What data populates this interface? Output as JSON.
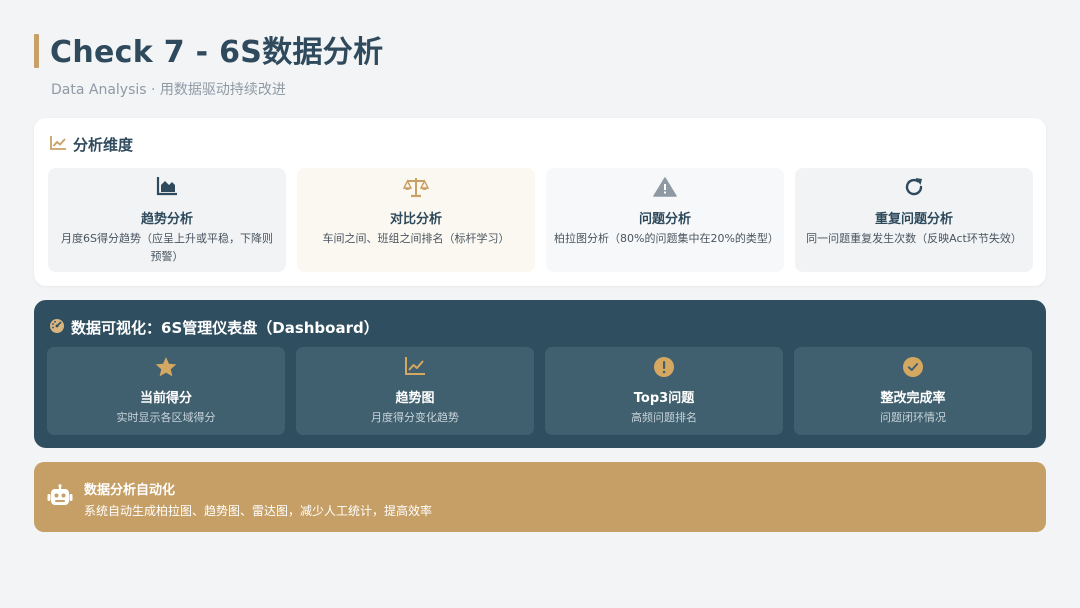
{
  "header": {
    "title": "Check 7 - 6S数据分析",
    "subtitle": "Data Analysis · 用数据驱动持续改进"
  },
  "dimensions": {
    "title": "分析维度",
    "icon": "line-chart-icon",
    "items": [
      {
        "name": "趋势分析",
        "desc": "月度6S得分趋势（应呈上升或平稳，下降则预警）",
        "icon": "area-chart-icon",
        "bg": "#f1f3f5"
      },
      {
        "name": "对比分析",
        "desc": "车间之间、班组之间排名（标杆学习）",
        "icon": "balance-scale-icon",
        "bg": "#fbf8f2"
      },
      {
        "name": "问题分析",
        "desc": "柏拉图分析（80%的问题集中在20%的类型）",
        "icon": "warning-icon",
        "bg": "#f7f8f9"
      },
      {
        "name": "重复问题分析",
        "desc": "同一问题重复发生次数（反映Act环节失效）",
        "icon": "redo-icon",
        "bg": "#f1f3f5"
      }
    ]
  },
  "dashboard": {
    "title": "数据可视化：6S管理仪表盘（Dashboard）",
    "icon": "gauge-icon",
    "items": [
      {
        "name": "当前得分",
        "desc": "实时显示各区域得分",
        "icon": "star-icon"
      },
      {
        "name": "趋势图",
        "desc": "月度得分变化趋势",
        "icon": "line-chart-icon"
      },
      {
        "name": "Top3问题",
        "desc": "高频问题排名",
        "icon": "exclamation-circle-icon"
      },
      {
        "name": "整改完成率",
        "desc": "问题闭环情况",
        "icon": "check-circle-icon"
      }
    ]
  },
  "automation": {
    "title": "数据分析自动化",
    "desc": "系统自动生成柏拉图、趋势图、雷达图，减少人工统计，提高效率",
    "icon": "robot-icon"
  },
  "colors": {
    "accent": "#c9a065",
    "navy": "#2f4e60",
    "tile": "#41606f",
    "text": "#2e4a5c"
  }
}
